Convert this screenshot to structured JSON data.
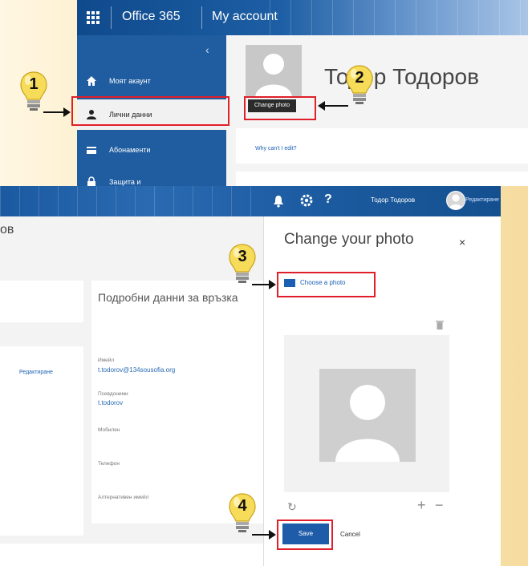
{
  "top": {
    "brand": "Office 365",
    "section": "My account",
    "nav_items": [
      {
        "label": "Моят акаунт",
        "icon": "home-icon"
      },
      {
        "label": "Лични данни",
        "icon": "person-icon"
      },
      {
        "label": "Абонаменти",
        "icon": "card-icon"
      },
      {
        "label": "Защита и",
        "icon": "lock-icon"
      }
    ],
    "user_name": "Тодор Тодоров",
    "change_photo": "Change photo",
    "why_cant_edit": "Why can't I edit?"
  },
  "bottom": {
    "user_name": "Тодор Тодоров",
    "edit_label": "Редактиране",
    "name_fragment": "ов",
    "contact": {
      "title": "Подробни данни за връзка",
      "email_label": "Имейл",
      "email_value": "t.todorov@134sousofia.org",
      "alias_label": "Псевдоними",
      "alias_value": "t.todorov",
      "mobile_label": "Мобилен",
      "phone_label": "Телефон",
      "alt_email_label": "Алтернативен имейл"
    },
    "panel": {
      "title": "Change your photo",
      "close": "×",
      "choose": "Choose a photo",
      "save": "Save",
      "cancel": "Cancel"
    }
  },
  "callouts": [
    "1",
    "2",
    "3",
    "4"
  ],
  "colors": {
    "accent": "#1e5caa",
    "highlight": "#e01f2a",
    "bulb": "#f7dc5a"
  }
}
